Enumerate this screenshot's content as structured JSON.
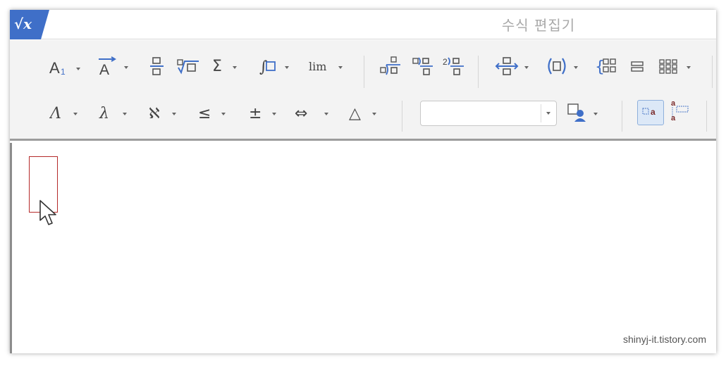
{
  "window": {
    "title": "수식 편집기",
    "app_icon": "sqrt-x-logo-icon",
    "accent_color": "#3f6fc8"
  },
  "toolbar": {
    "row1": [
      {
        "name": "font-size-button",
        "icon": "font-size-icon",
        "label": "A",
        "sub": "1",
        "has_dropdown": true
      },
      {
        "name": "accent-button",
        "icon": "vector-accent-icon",
        "label": "A",
        "has_dropdown": true
      },
      {
        "name": "fraction-button",
        "icon": "fraction-icon",
        "has_dropdown": false
      },
      {
        "name": "root-button",
        "icon": "root-icon",
        "has_dropdown": false
      },
      {
        "name": "sum-button",
        "icon": "sigma-icon",
        "label": "Σ",
        "has_dropdown": true
      },
      {
        "name": "integral-button",
        "icon": "integral-icon",
        "label": "∫",
        "has_dropdown": true
      },
      {
        "name": "limit-button",
        "icon": "limit-icon",
        "label": "lim",
        "has_dropdown": true
      },
      {
        "name": "long-division-button",
        "icon": "long-division-icon",
        "has_dropdown": false
      },
      {
        "name": "division-button",
        "icon": "division-icon",
        "has_dropdown": false
      },
      {
        "name": "nth-division-button",
        "icon": "nth-division-icon",
        "label": "2",
        "has_dropdown": false
      },
      {
        "name": "stack-button",
        "icon": "stack-arrow-icon",
        "has_dropdown": true
      },
      {
        "name": "parentheses-button",
        "icon": "parentheses-icon",
        "label": "(□)",
        "has_dropdown": true
      },
      {
        "name": "cases-button",
        "icon": "cases-icon",
        "label": "{",
        "has_dropdown": false
      },
      {
        "name": "rows-button",
        "icon": "rows-icon",
        "has_dropdown": false
      },
      {
        "name": "matrix-button",
        "icon": "matrix-icon",
        "has_dropdown": true
      }
    ],
    "row2": [
      {
        "name": "greek-upper-button",
        "icon": "greek-upper-icon",
        "label": "Λ",
        "has_dropdown": true
      },
      {
        "name": "greek-lower-button",
        "icon": "greek-lower-icon",
        "label": "λ",
        "has_dropdown": true
      },
      {
        "name": "hebrew-button",
        "icon": "aleph-icon",
        "label": "ℵ",
        "has_dropdown": true
      },
      {
        "name": "relation-button",
        "icon": "less-equal-icon",
        "label": "≤",
        "has_dropdown": true
      },
      {
        "name": "operator-button",
        "icon": "plus-minus-icon",
        "label": "±",
        "has_dropdown": true
      },
      {
        "name": "arrow-button",
        "icon": "double-arrow-icon",
        "label": "⇔",
        "has_dropdown": true
      },
      {
        "name": "misc-symbol-button",
        "icon": "triangle-icon",
        "label": "△",
        "has_dropdown": true
      }
    ],
    "font_combo": {
      "value": ""
    },
    "color_button": {
      "icon": "color-person-icon",
      "has_dropdown": true
    },
    "layout_toggles": [
      {
        "name": "inline-toggle",
        "icon": "inline-layout-icon",
        "active": true
      },
      {
        "name": "display-toggle",
        "icon": "display-layout-icon",
        "active": false
      }
    ]
  },
  "editor": {
    "placeholder": "empty-input-box",
    "watermark": "shinyj-it.tistory.com",
    "placeholder_color": "#b52a2a"
  }
}
